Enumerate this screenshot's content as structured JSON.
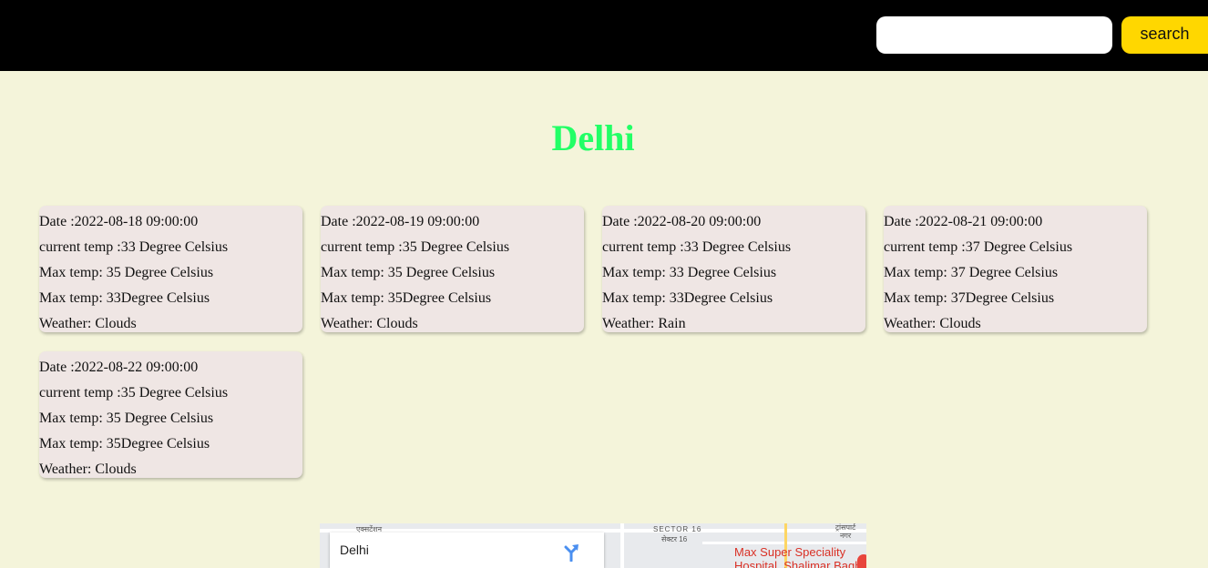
{
  "header": {
    "search": {
      "value": "",
      "placeholder": ""
    },
    "search_button_label": "search"
  },
  "city": "Delhi",
  "forecast": [
    {
      "date": "Date :2022-08-18 09:00:00",
      "current": "current temp :33 Degree Celsius",
      "max": "Max temp: 35 Degree Celsius",
      "min": "Max temp: 33Degree Celsius",
      "weather": "Weather: Clouds"
    },
    {
      "date": "Date :2022-08-19 09:00:00",
      "current": "current temp :35 Degree Celsius",
      "max": "Max temp: 35 Degree Celsius",
      "min": "Max temp: 35Degree Celsius",
      "weather": "Weather: Clouds"
    },
    {
      "date": "Date :2022-08-20 09:00:00",
      "current": "current temp :33 Degree Celsius",
      "max": "Max temp: 33 Degree Celsius",
      "min": "Max temp: 33Degree Celsius",
      "weather": "Weather: Rain"
    },
    {
      "date": "Date :2022-08-21 09:00:00",
      "current": "current temp :37 Degree Celsius",
      "max": "Max temp: 37 Degree Celsius",
      "min": "Max temp: 37Degree Celsius",
      "weather": "Weather: Clouds"
    },
    {
      "date": "Date :2022-08-22 09:00:00",
      "current": "current temp :35 Degree Celsius",
      "max": "Max temp: 35 Degree Celsius",
      "min": "Max temp: 35Degree Celsius",
      "weather": "Weather: Clouds"
    }
  ],
  "map": {
    "place_title": "Delhi",
    "directions_icon": "directions-icon",
    "poi": "Max Super Speciality\nHospital, Shalimar Bagh",
    "labels": {
      "extension": "एक्सटेंशन",
      "sector_en": "SECTOR 16",
      "sector_hi": "सेक्टर 16",
      "nagar": "ट्रांसपार्ट\nनगर"
    }
  },
  "colors": {
    "header_bg": "#000000",
    "page_bg": "#f4f4da",
    "button_bg": "#ffd700",
    "city_title": "#22ff66",
    "card_bg": "#efe6e4"
  }
}
